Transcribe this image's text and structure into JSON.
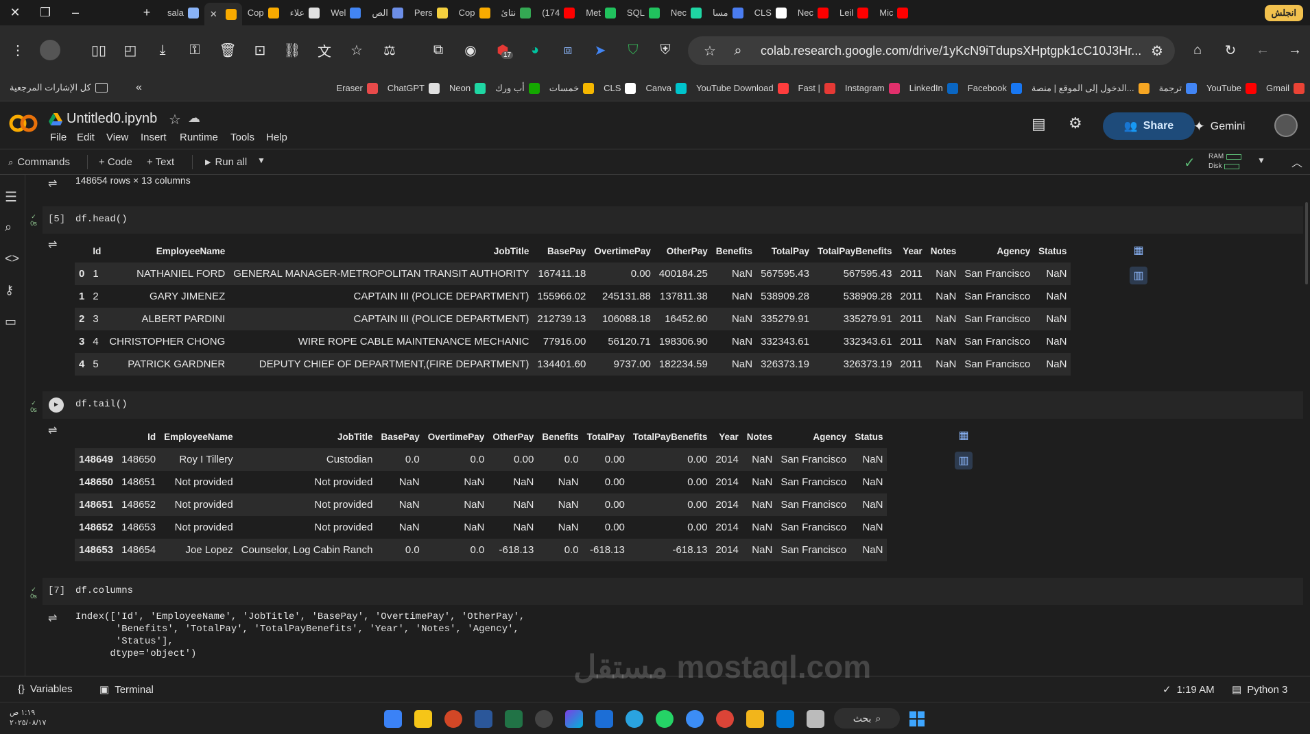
{
  "browser": {
    "tabs": [
      {
        "label": "sala",
        "color": "#8ab4f8"
      },
      {
        "label": "",
        "color": "#f9ab00",
        "active": true
      },
      {
        "label": "Cop",
        "color": "#f9ab00"
      },
      {
        "label": "علاء",
        "color": "#e0e0e0"
      },
      {
        "label": "Wel",
        "color": "#4285f4"
      },
      {
        "label": "الص",
        "color": "#6c8ee8"
      },
      {
        "label": "Pers",
        "color": "#f4d03f"
      },
      {
        "label": "Cop",
        "color": "#f9ab00"
      },
      {
        "label": "نتائ",
        "color": "#34a853"
      },
      {
        "label": "(174",
        "color": "#ff0000"
      },
      {
        "label": "Met",
        "color": "#21c25e"
      },
      {
        "label": "SQL",
        "color": "#21c25e"
      },
      {
        "label": "Nec",
        "color": "#1fd6a3"
      },
      {
        "label": "مسا",
        "color": "#4a7cf0"
      },
      {
        "label": "CLS",
        "color": "#ffffff"
      },
      {
        "label": "Nec",
        "color": "#ff0000"
      },
      {
        "label": "Leil",
        "color": "#ff0000"
      },
      {
        "label": "Mic",
        "color": "#ff0000"
      }
    ],
    "profile_label": "انجلش",
    "url": "colab.research.google.com/drive/1yKcN9iTdupsXHptgpk1cC10J3Hr...",
    "bookmarks": [
      {
        "label": "Gmail",
        "color": "#ea4335"
      },
      {
        "label": "YouTube",
        "color": "#ff0000"
      },
      {
        "label": "ترجمة",
        "color": "#4285f4"
      },
      {
        "label": "الدخول إلى الموقع | منصة...",
        "color": "#f6a623"
      },
      {
        "label": "Facebook",
        "color": "#1877f2"
      },
      {
        "label": "LinkedIn",
        "color": "#0a66c2"
      },
      {
        "label": "Instagram",
        "color": "#e1306c"
      },
      {
        "label": "Fast |",
        "color": "#e53935"
      },
      {
        "label": "YouTube Download",
        "color": "#ff3d3d"
      },
      {
        "label": "Canva",
        "color": "#00c4cc"
      },
      {
        "label": "CLS",
        "color": "#ffffff"
      },
      {
        "label": "خمسات",
        "color": "#f5b700"
      },
      {
        "label": "أب ورك",
        "color": "#14a800"
      },
      {
        "label": "Neon",
        "color": "#1fd6a3"
      },
      {
        "label": "ChatGPT",
        "color": "#e0e0e0"
      },
      {
        "label": "Eraser",
        "color": "#e84a4a"
      }
    ],
    "all_bookmarks_label": "كل الإشارات المرجعية",
    "extension_badge": "17"
  },
  "colab": {
    "notebook_title": "Untitled0.ipynb",
    "menus": [
      "File",
      "Edit",
      "View",
      "Insert",
      "Runtime",
      "Tools",
      "Help"
    ],
    "share_label": "Share",
    "gemini_label": "Gemini",
    "commands_label": "Commands",
    "add_code_label": "+ Code",
    "add_text_label": "+ Text",
    "run_all_label": "Run all",
    "ram_label": "RAM",
    "disk_label": "Disk",
    "variables_label": "Variables",
    "terminal_label": "Terminal",
    "status_time": "1:19 AM",
    "runtime_label": "Python 3"
  },
  "cells": {
    "prev_output": "148654 rows × 13 columns",
    "head": {
      "prompt": "[5]",
      "code": "df.head()",
      "exec_time": "0s",
      "columns": [
        "",
        "Id",
        "EmployeeName",
        "JobTitle",
        "BasePay",
        "OvertimePay",
        "OtherPay",
        "Benefits",
        "TotalPay",
        "TotalPayBenefits",
        "Year",
        "Notes",
        "Agency",
        "Status"
      ],
      "rows": [
        [
          "0",
          "1",
          "NATHANIEL FORD",
          "GENERAL MANAGER-METROPOLITAN TRANSIT AUTHORITY",
          "167411.18",
          "0.00",
          "400184.25",
          "NaN",
          "567595.43",
          "567595.43",
          "2011",
          "NaN",
          "San Francisco",
          "NaN"
        ],
        [
          "1",
          "2",
          "GARY JIMENEZ",
          "CAPTAIN III (POLICE DEPARTMENT)",
          "155966.02",
          "245131.88",
          "137811.38",
          "NaN",
          "538909.28",
          "538909.28",
          "2011",
          "NaN",
          "San Francisco",
          "NaN"
        ],
        [
          "2",
          "3",
          "ALBERT PARDINI",
          "CAPTAIN III (POLICE DEPARTMENT)",
          "212739.13",
          "106088.18",
          "16452.60",
          "NaN",
          "335279.91",
          "335279.91",
          "2011",
          "NaN",
          "San Francisco",
          "NaN"
        ],
        [
          "3",
          "4",
          "CHRISTOPHER CHONG",
          "WIRE ROPE CABLE MAINTENANCE MECHANIC",
          "77916.00",
          "56120.71",
          "198306.90",
          "NaN",
          "332343.61",
          "332343.61",
          "2011",
          "NaN",
          "San Francisco",
          "NaN"
        ],
        [
          "4",
          "5",
          "PATRICK GARDNER",
          "DEPUTY CHIEF OF DEPARTMENT,(FIRE DEPARTMENT)",
          "134401.60",
          "9737.00",
          "182234.59",
          "NaN",
          "326373.19",
          "326373.19",
          "2011",
          "NaN",
          "San Francisco",
          "NaN"
        ]
      ]
    },
    "tail": {
      "code": "df.tail()",
      "exec_time": "0s",
      "columns": [
        "",
        "Id",
        "EmployeeName",
        "JobTitle",
        "BasePay",
        "OvertimePay",
        "OtherPay",
        "Benefits",
        "TotalPay",
        "TotalPayBenefits",
        "Year",
        "Notes",
        "Agency",
        "Status"
      ],
      "rows": [
        [
          "148649",
          "148650",
          "Roy I Tillery",
          "Custodian",
          "0.0",
          "0.0",
          "0.00",
          "0.0",
          "0.00",
          "0.00",
          "2014",
          "NaN",
          "San Francisco",
          "NaN"
        ],
        [
          "148650",
          "148651",
          "Not provided",
          "Not provided",
          "NaN",
          "NaN",
          "NaN",
          "NaN",
          "0.00",
          "0.00",
          "2014",
          "NaN",
          "San Francisco",
          "NaN"
        ],
        [
          "148651",
          "148652",
          "Not provided",
          "Not provided",
          "NaN",
          "NaN",
          "NaN",
          "NaN",
          "0.00",
          "0.00",
          "2014",
          "NaN",
          "San Francisco",
          "NaN"
        ],
        [
          "148652",
          "148653",
          "Not provided",
          "Not provided",
          "NaN",
          "NaN",
          "NaN",
          "NaN",
          "0.00",
          "0.00",
          "2014",
          "NaN",
          "San Francisco",
          "NaN"
        ],
        [
          "148653",
          "148654",
          "Joe Lopez",
          "Counselor, Log Cabin Ranch",
          "0.0",
          "0.0",
          "-618.13",
          "0.0",
          "-618.13",
          "-618.13",
          "2014",
          "NaN",
          "San Francisco",
          "NaN"
        ]
      ]
    },
    "columns_cell": {
      "prompt": "[7]",
      "code": "df.columns",
      "exec_time": "0s",
      "output": "Index(['Id', 'EmployeeName', 'JobTitle', 'BasePay', 'OvertimePay', 'OtherPay',\n       'Benefits', 'TotalPay', 'TotalPayBenefits', 'Year', 'Notes', 'Agency',\n       'Status'],\n      dtype='object')"
    }
  },
  "taskbar": {
    "search_label": "بحث",
    "clock_time": "١:١٩ ص",
    "clock_date": "٢٠٢٥/٠٨/١٧"
  },
  "watermark": "مستقل mostaql.com"
}
